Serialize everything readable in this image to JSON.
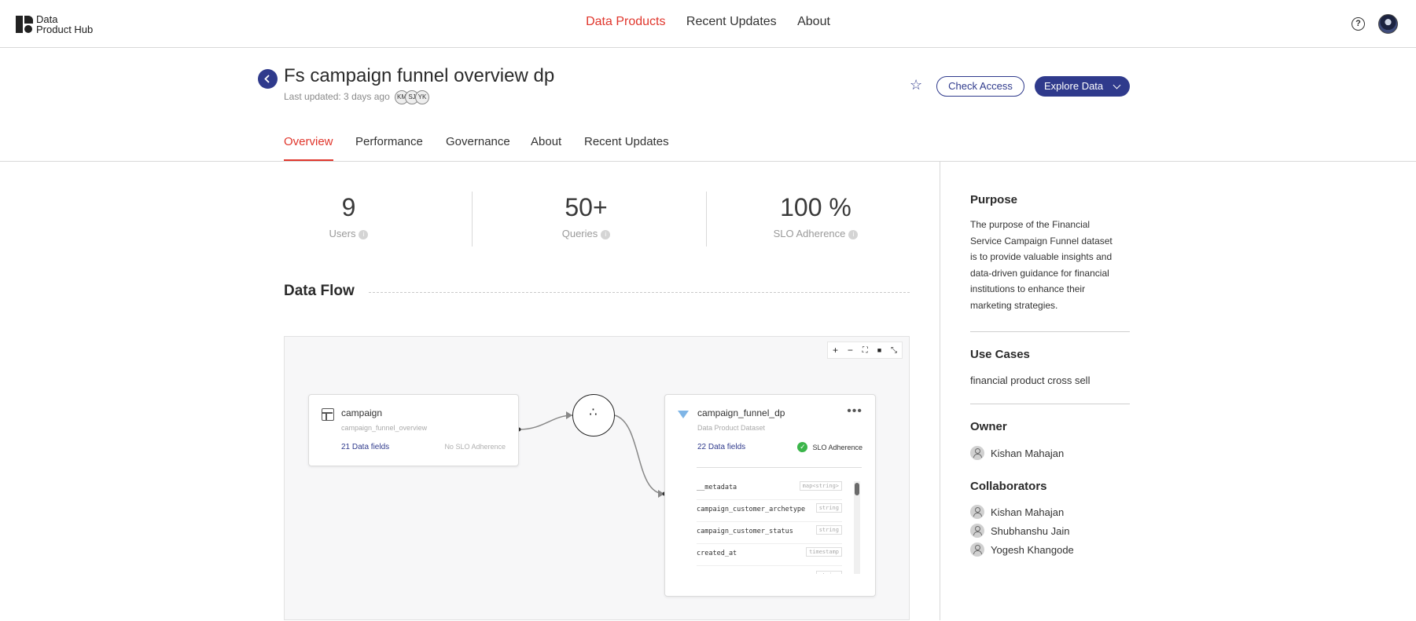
{
  "app": {
    "logo_line1": "Data",
    "logo_line2": "Product Hub",
    "nav": [
      "Data Products",
      "Recent Updates",
      "About"
    ]
  },
  "header": {
    "title": "Fs campaign funnel overview dp",
    "last_updated": "Last updated: 3 days ago",
    "collaborator_chips": [
      "KM",
      "SJ",
      "YK"
    ],
    "check_access": "Check Access",
    "explore_data": "Explore Data"
  },
  "tabs": [
    "Overview",
    "Performance",
    "Governance",
    "About",
    "Recent Updates"
  ],
  "stats": [
    {
      "value": "9",
      "label": "Users"
    },
    {
      "value": "50+",
      "label": "Queries"
    },
    {
      "value": "100 %",
      "label": "SLO Adherence"
    }
  ],
  "data_flow": {
    "title": "Data Flow",
    "zoom_controls": [
      "+",
      "−",
      "⛶",
      "🔒",
      "⤡"
    ],
    "source_node": {
      "name": "campaign",
      "sub": "campaign_funnel_overview",
      "fields": "21 Data fields",
      "slo": "No SLO Adherence"
    },
    "target_node": {
      "name": "campaign_funnel_dp",
      "sub": "Data Product Dataset",
      "fields": "22 Data fields",
      "slo": "SLO Adherence",
      "columns": [
        {
          "name": "__metadata",
          "type": "map<string>"
        },
        {
          "name": "campaign_customer_archetype",
          "type": "string"
        },
        {
          "name": "campaign_customer_status",
          "type": "string"
        },
        {
          "name": "created_at",
          "type": "timestamp"
        },
        {
          "name": "",
          "type": "string"
        }
      ]
    }
  },
  "side": {
    "purpose_title": "Purpose",
    "purpose_lines": [
      "The purpose of the Financial",
      "Service Campaign Funnel dataset",
      "is to provide valuable insights and",
      "data-driven guidance for financial",
      "institutions to enhance their",
      "marketing strategies."
    ],
    "use_cases_title": "Use Cases",
    "use_cases": "financial product cross sell",
    "owner_title": "Owner",
    "owner": "Kishan Mahajan",
    "collaborators_title": "Collaborators",
    "collaborators": [
      "Kishan Mahajan",
      "Shubhanshu Jain",
      "Yogesh Khangode"
    ]
  },
  "colors": {
    "accent": "#e0362c",
    "primary": "#2f3a8c",
    "success": "#3bb54a"
  }
}
